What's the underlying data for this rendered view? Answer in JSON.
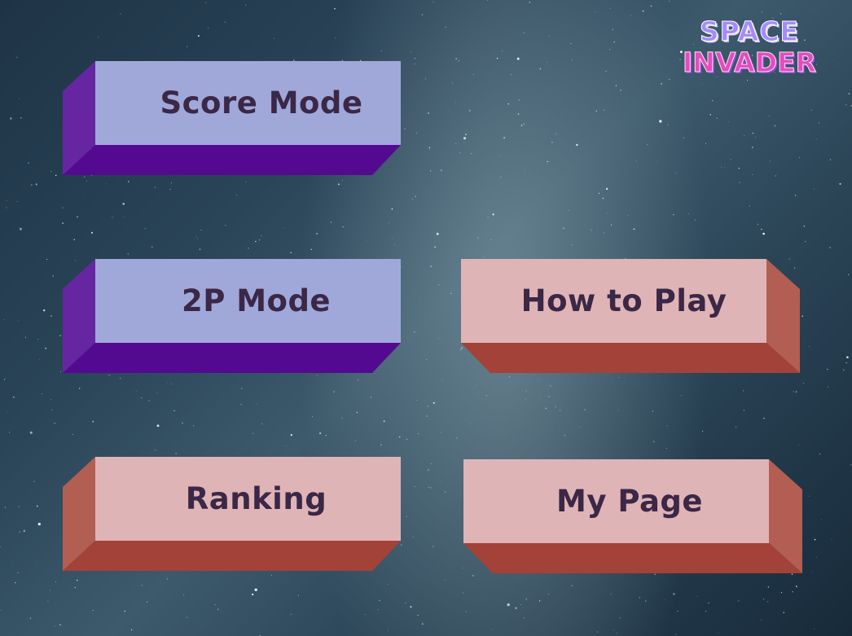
{
  "logo": {
    "line1": "SPACE",
    "line2": "INVADER"
  },
  "menu": {
    "score_mode": "Score Mode",
    "two_player_mode": "2P Mode",
    "how_to_play": "How to Play",
    "ranking": "Ranking",
    "my_page": "My Page"
  },
  "colors": {
    "blue_face": "#a0a8da",
    "purple_side": "#6626a2",
    "purple_bottom": "#540a90",
    "pink_face": "#dfb4b6",
    "red_side": "#b25e53",
    "red_bottom": "#a34238",
    "label_text": "#3b2746"
  }
}
